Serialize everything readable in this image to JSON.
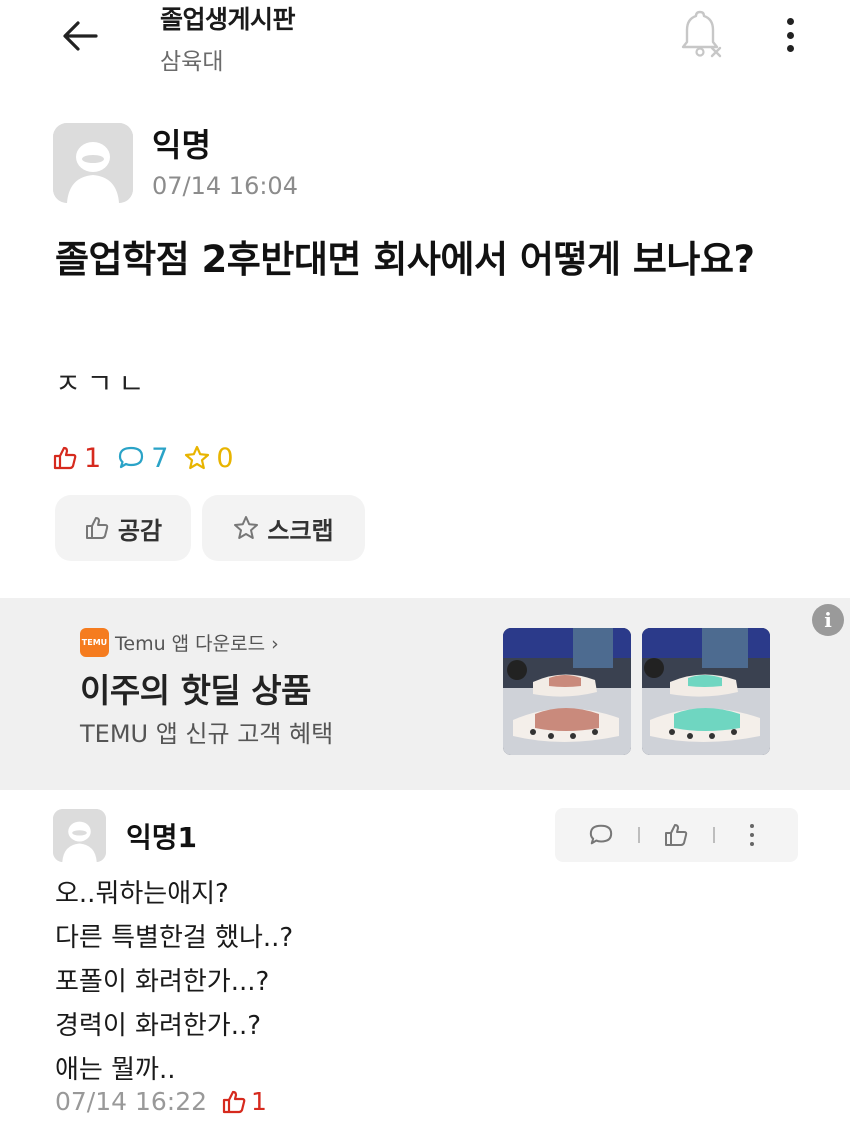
{
  "header": {
    "board_title": "졸업생게시판",
    "board_subtitle": "삼육대"
  },
  "post": {
    "author": "익명",
    "time": "07/14 16:04",
    "title": "졸업학점 2후반대면 회사에서 어떻게 보나요?",
    "body": "ㅈㄱㄴ",
    "likes": "1",
    "comments": "7",
    "scraps": "0",
    "empathy_label": "공감",
    "scrap_label": "스크랩"
  },
  "ad": {
    "brand_label": "Temu 앱 다운로드 ›",
    "logo_text": "TEMU",
    "title": "이주의 핫딜 상품",
    "description": "TEMU 앱 신규 고객 혜택",
    "info_icon_label": "i"
  },
  "comment": {
    "author": "익명1",
    "lines": [
      "오..뭐하는애지?",
      "다른 특별한걸 했나..?",
      "포폴이 화려한가...?",
      "경력이 화려한가..?",
      "애는 뭘까.."
    ],
    "time": "07/14 16:22",
    "likes": "1"
  },
  "colors": {
    "like_red": "#d62a1e",
    "comment_blue": "#2aa3c7",
    "scrap_yellow": "#e8b400",
    "temu_orange": "#f57c1f"
  },
  "icons": [
    "back-arrow-icon",
    "bell-off-icon",
    "more-vertical-icon",
    "thumbs-up-icon",
    "speech-bubble-icon",
    "star-icon",
    "info-icon"
  ]
}
